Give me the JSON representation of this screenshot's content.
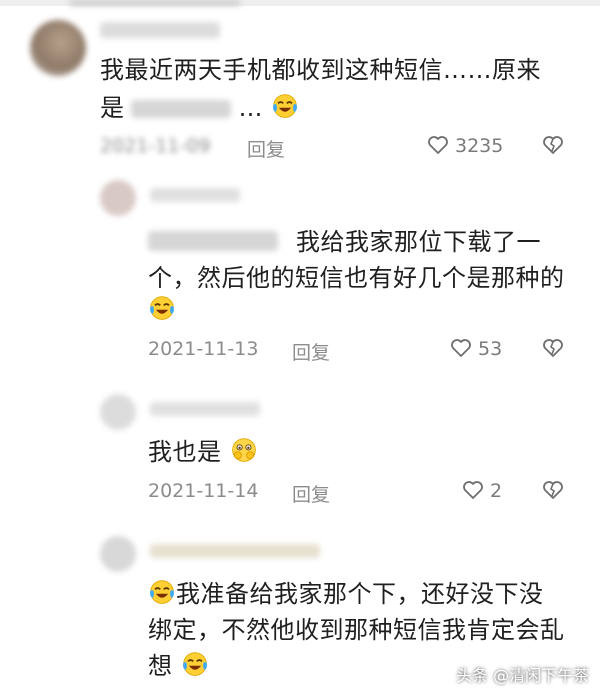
{
  "comments": [
    {
      "text_line1": "我最近两天手机都收到这种短信……原来",
      "text_line2_prefix": "是",
      "text_line2_suffix": "…",
      "date": "2021-11-09",
      "reply_label": "回复",
      "likes": "3235"
    },
    {
      "text_line1": "我给我家那位下载了一",
      "text_line2": "个，然后他的短信也有好几个是那种的",
      "date": "2021-11-13",
      "reply_label": "回复",
      "likes": "53"
    },
    {
      "text_line1": "我也是",
      "date": "2021-11-14",
      "reply_label": "回复",
      "likes": "2"
    },
    {
      "text_line1": "我准备给我家那个下，还好没下没",
      "text_line2": "绑定，不然他收到那种短信我肯定会乱",
      "text_line3": "想"
    }
  ],
  "watermark": "头条 @清闲下午茶",
  "icons": {
    "like": "heart-outline-icon",
    "dislike": "broken-heart-icon",
    "laugh": "laughing-tears-emoji",
    "shy": "shy-face-emoji"
  }
}
